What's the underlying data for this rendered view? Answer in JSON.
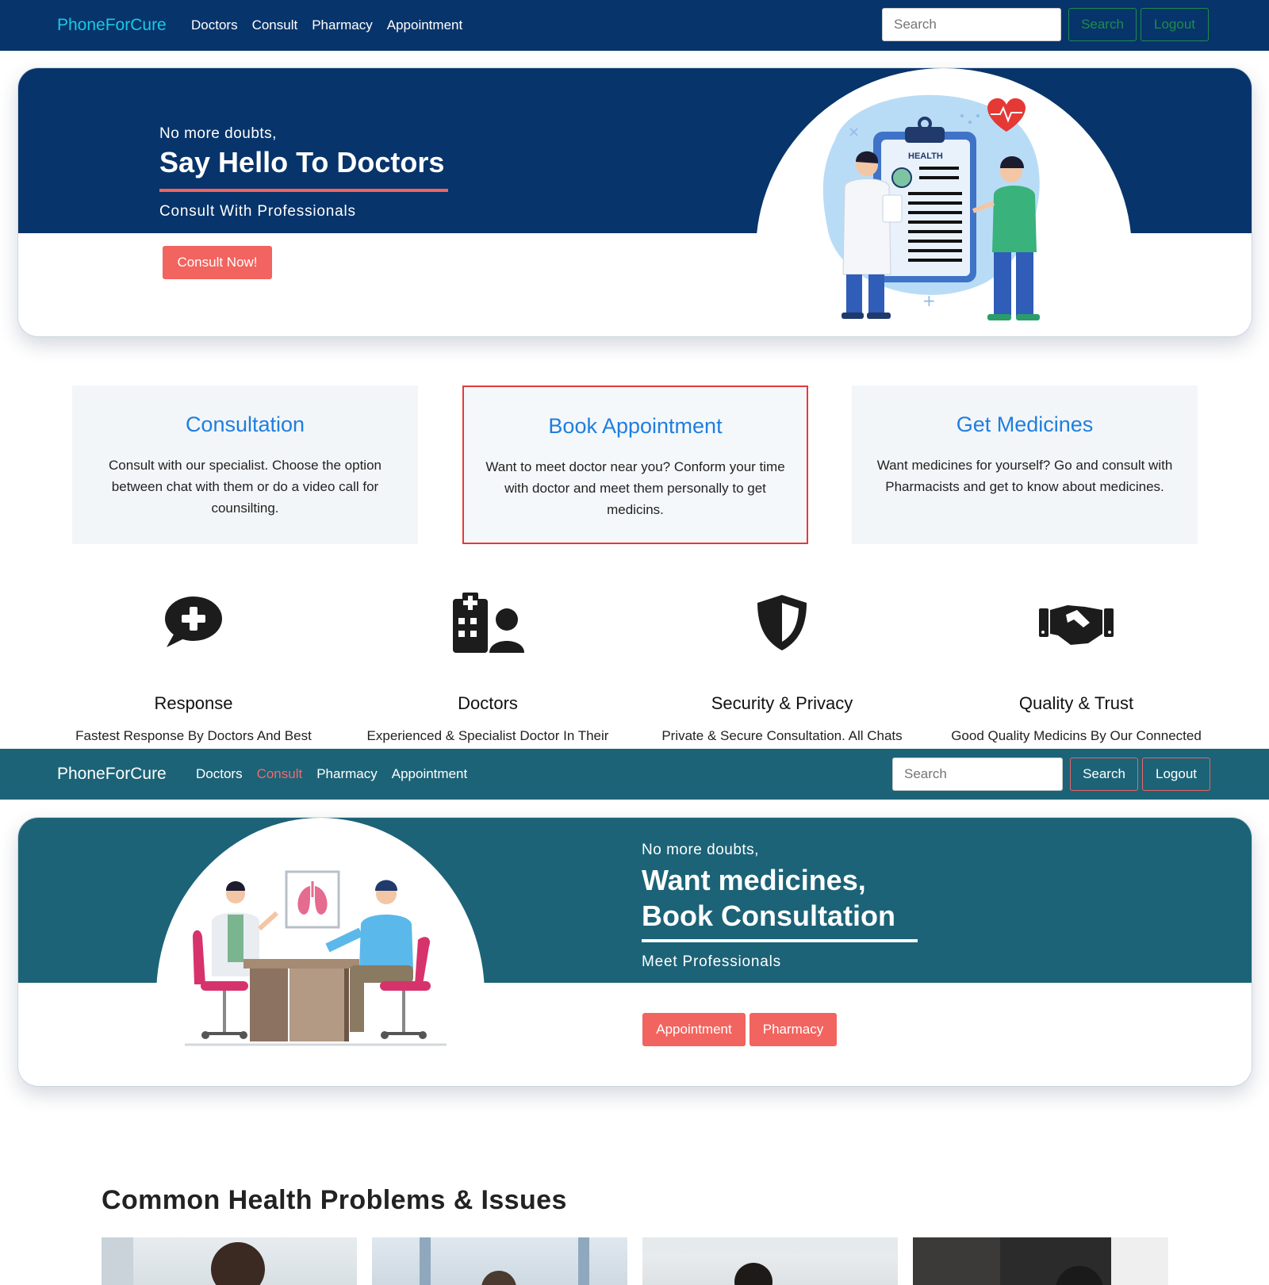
{
  "nav_top": {
    "brand": "PhoneForCure",
    "links": [
      "Doctors",
      "Consult",
      "Pharmacy",
      "Appointment"
    ],
    "search_placeholder": "Search",
    "search_button": "Search",
    "logout_button": "Logout"
  },
  "hero_doctors": {
    "kicker": "No more doubts,",
    "title": "Say Hello To Doctors",
    "subtitle": "Consult With Professionals",
    "cta": "Consult Now!",
    "illustration_label": "HEALTH"
  },
  "services": [
    {
      "title": "Consultation",
      "text": "Consult with our specialist. Choose the option between chat with them or do a video call for counsilting."
    },
    {
      "title": "Book Appointment",
      "text": "Want to meet doctor near you? Conform your time with doctor and meet them personally to get medicins."
    },
    {
      "title": "Get Medicines",
      "text": "Want medicines for yourself? Go and consult with Pharmacists and get to know about medicines."
    }
  ],
  "features": [
    {
      "icon": "medical-chat-icon",
      "title": "Response",
      "text": "Fastest Response By Doctors And Best"
    },
    {
      "icon": "hospital-user-icon",
      "title": "Doctors",
      "text": "Experienced & Specialist Doctor In Their"
    },
    {
      "icon": "shield-icon",
      "title": "Security & Privacy",
      "text": "Private & Secure Consultation. All Chats"
    },
    {
      "icon": "handshake-icon",
      "title": "Quality & Trust",
      "text": "Good Quality Medicins By Our Connected"
    }
  ],
  "nav_second": {
    "brand": "PhoneForCure",
    "links": [
      "Doctors",
      "Consult",
      "Pharmacy",
      "Appointment"
    ],
    "active_link": "Consult",
    "search_placeholder": "Search",
    "search_button": "Search",
    "logout_button": "Logout"
  },
  "hero_medicines": {
    "kicker": "No more doubts,",
    "title_line1": "Want medicines,",
    "title_line2": "Book Consultation",
    "subtitle": "Meet Professionals",
    "buttons": [
      "Appointment",
      "Pharmacy"
    ]
  },
  "common_problems": {
    "title": "Common Health Problems & Issues"
  },
  "colors": {
    "navy": "#07346a",
    "teal": "#1c6377",
    "accent_red": "#f2645f",
    "link_blue": "#1f7ee0",
    "brand_cyan": "#19c9e8"
  }
}
